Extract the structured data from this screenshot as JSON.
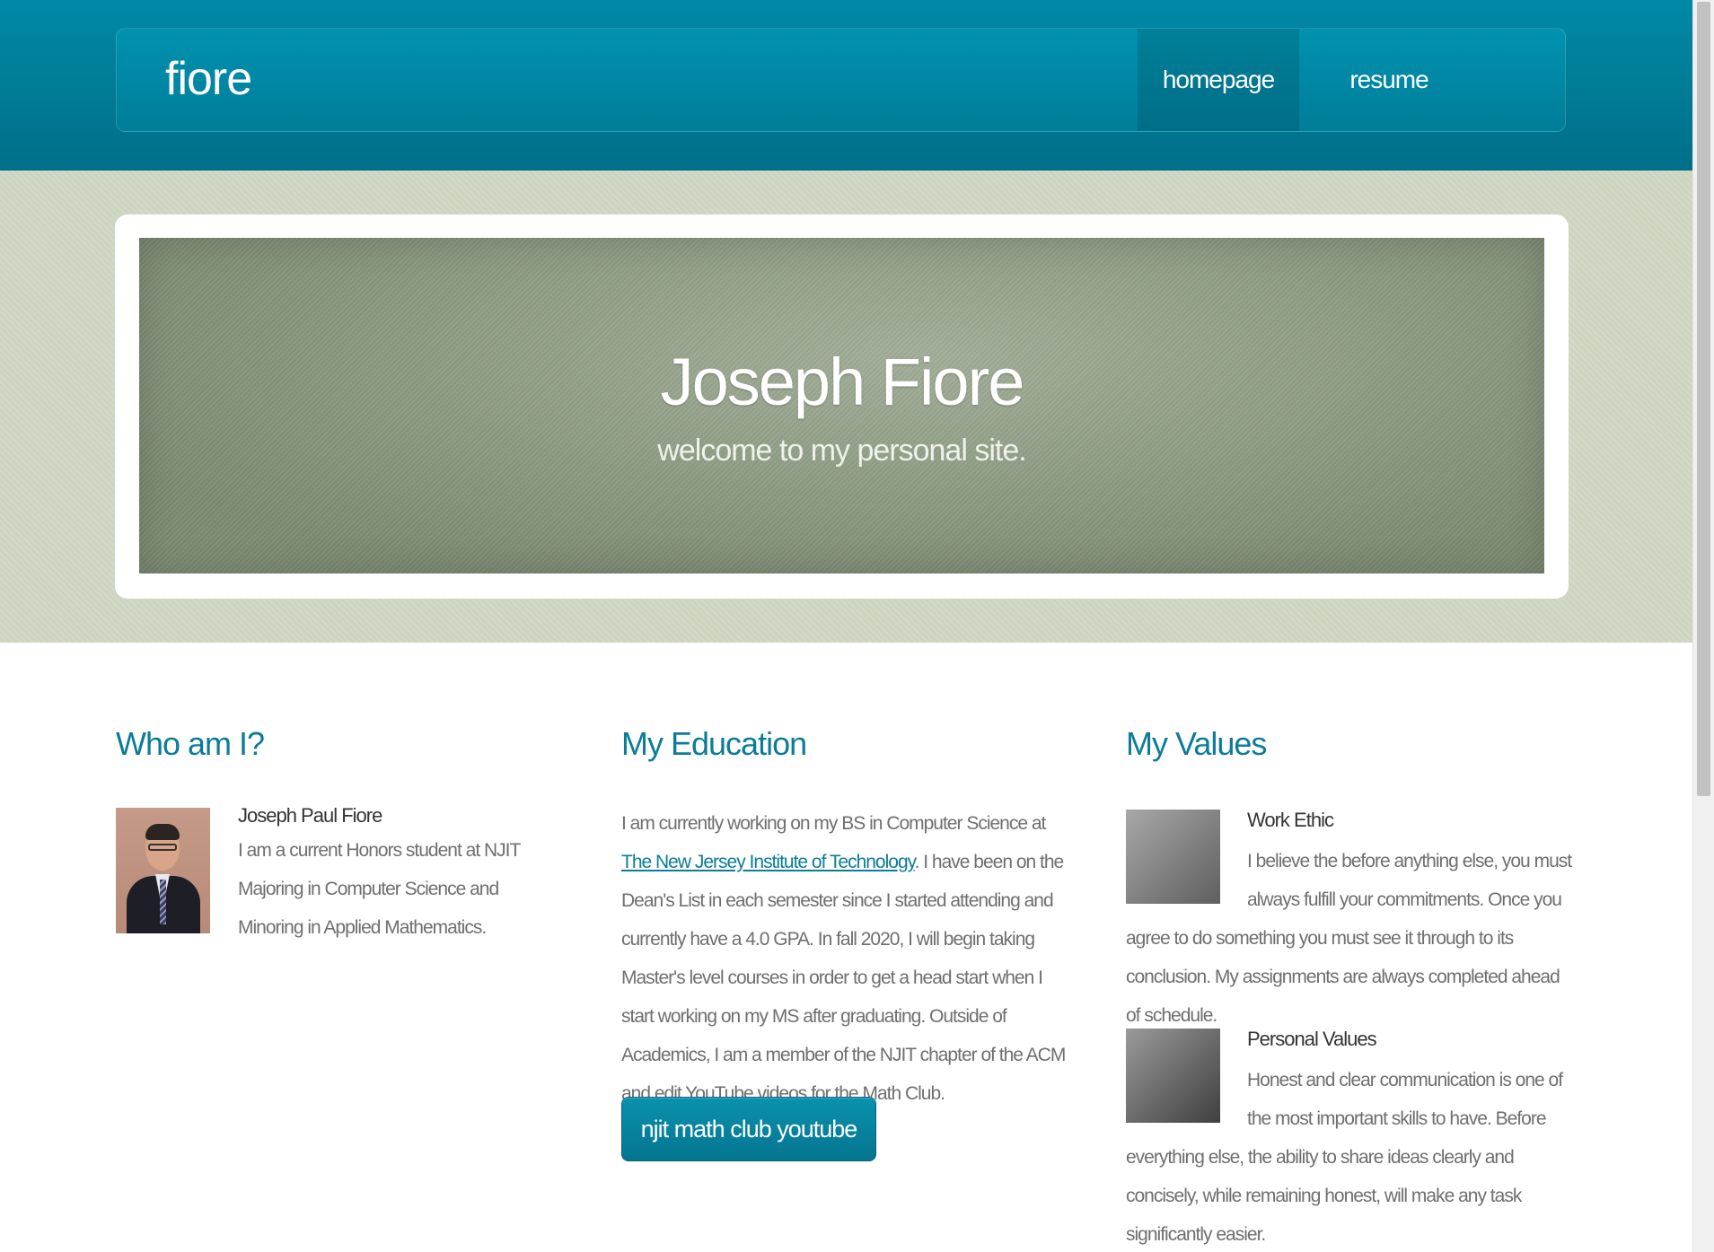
{
  "header": {
    "logo": "fiore",
    "nav": [
      {
        "label": "homepage",
        "active": true
      },
      {
        "label": "resume",
        "active": false
      }
    ]
  },
  "banner": {
    "title": "Joseph Fiore",
    "subtitle": "welcome to my personal site."
  },
  "who": {
    "heading": "Who am I?",
    "name": "Joseph Paul Fiore",
    "text": "I am a current Honors student at NJIT Majoring in Computer Science and Minoring in Applied Mathematics."
  },
  "education": {
    "heading": "My Education",
    "text_before": "I am currently working on my BS in Computer Science at ",
    "link_label": "The New Jersey Institute of Technology",
    "text_after": ". I have been on the Dean's List in each semester since I started attending and currently have a 4.0 GPA. In fall 2020, I will begin taking Master's level courses in order to get a head start when I start working on my MS after graduating. Outside of Academics, I am a member of the NJIT chapter of the ACM and edit YouTube videos for the Math Club.",
    "button_label": "njit math club youtube"
  },
  "values": {
    "heading": "My Values",
    "items": [
      {
        "title": "Work Ethic",
        "text": "I believe the before anything else, you must always fulfill your commitments. Once you agree to do something you must see it through to its conclusion. My assignments are always completed ahead of schedule."
      },
      {
        "title": "Personal Values",
        "text": "Honest and clear communication is one of the most important skills to have. Before everything else, the ability to share ideas clearly and concisely, while remaining honest, will make any task significantly easier."
      }
    ]
  },
  "colors": {
    "brand": "#0089a6",
    "heading": "#0c7c97",
    "banner": "#8c9c81",
    "band": "#cdd5c1"
  }
}
